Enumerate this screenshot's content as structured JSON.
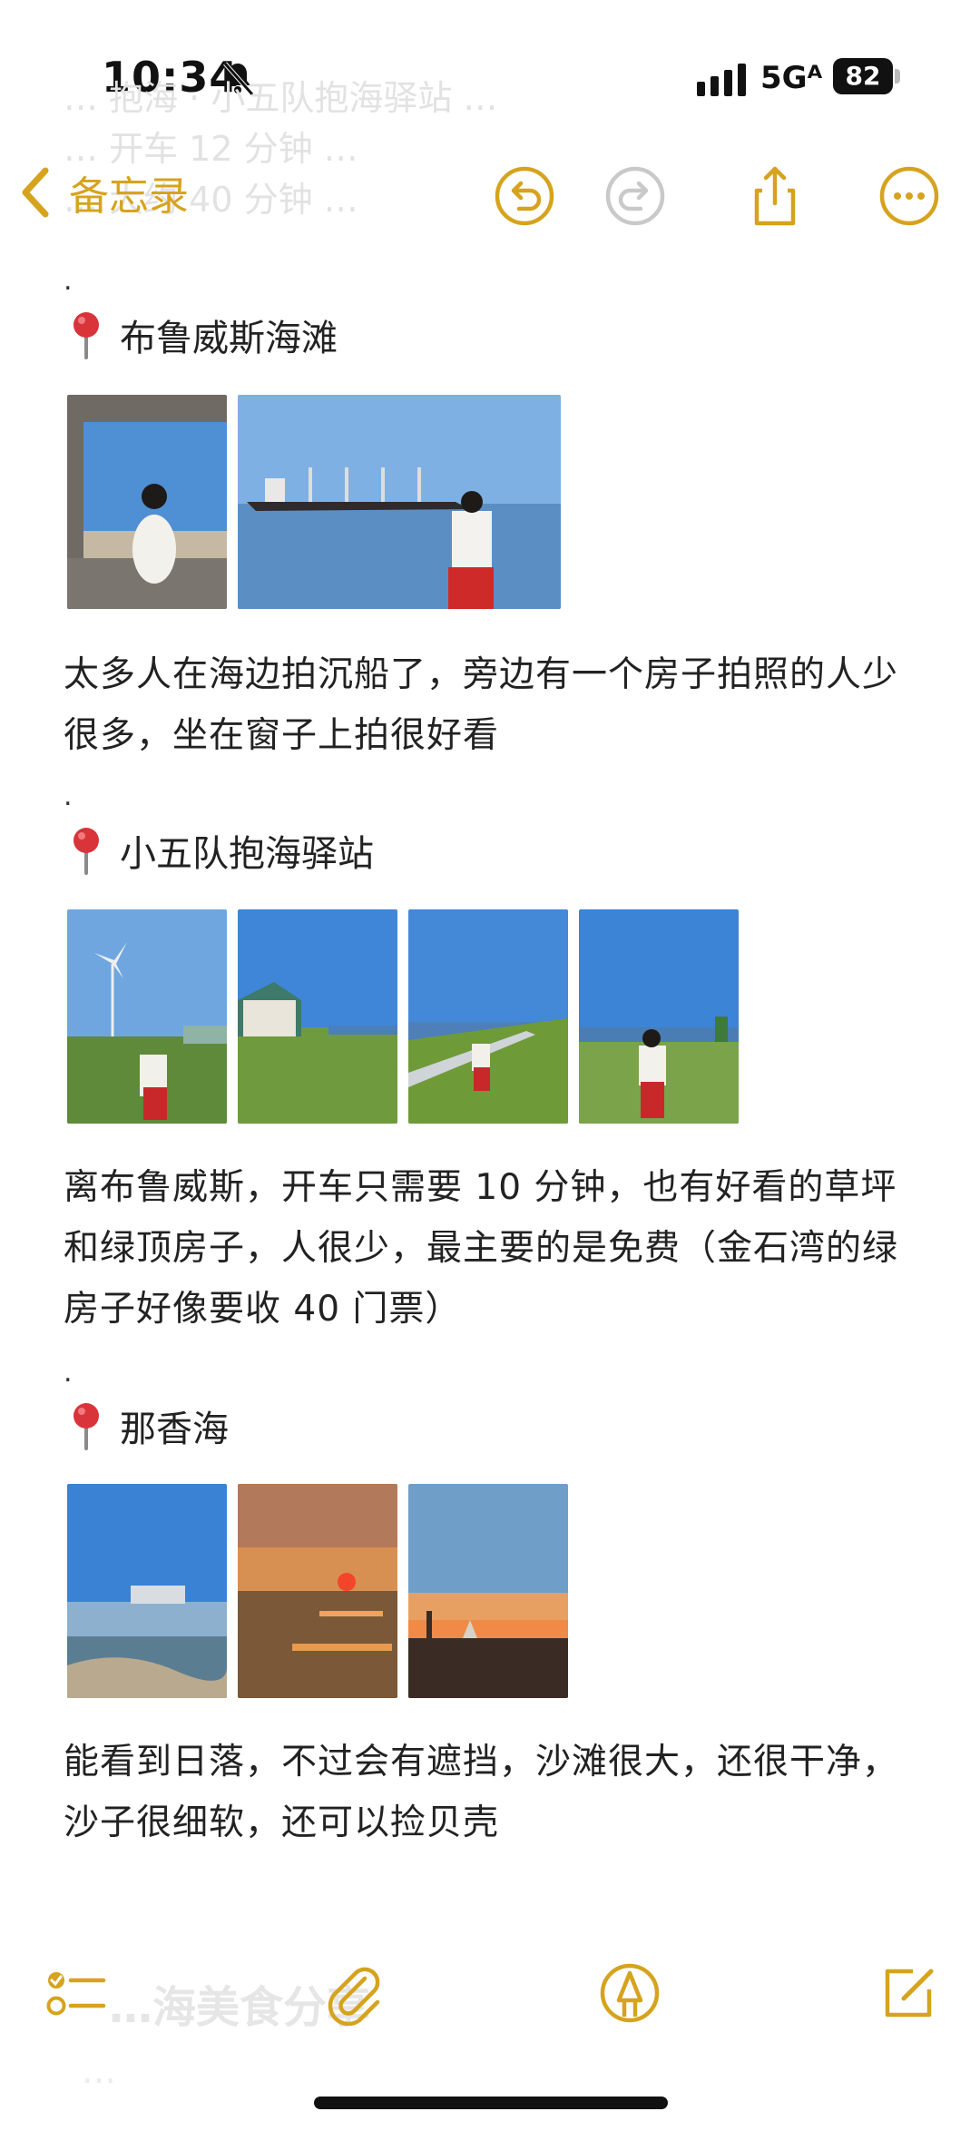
{
  "status": {
    "time": "10:34",
    "network": "5Gᴬ",
    "battery": "82"
  },
  "ghost": {
    "line1": "… 抱海 · 小五队抱海驿站 …",
    "line2": "… 开车 12 分钟 …",
    "line3": "… 大约 40 分钟 …"
  },
  "nav": {
    "back_label": "备忘录"
  },
  "sections": [
    {
      "dot": ".",
      "title": "布鲁威斯海滩",
      "paragraph": "太多人在海边拍沉船了，旁边有一个房子拍照的人少很多，坐在窗子上拍很好看"
    },
    {
      "dot": ".",
      "title": "小五队抱海驿站",
      "paragraph": "离布鲁威斯，开车只需要 10 分钟，也有好看的草坪和绿顶房子，人很少，最主要的是免费（金石湾的绿房子好像要收 40 门票）"
    },
    {
      "dot": ".",
      "title": "那香海",
      "paragraph": "能看到日落，不过会有遮挡，沙滩很大，还很干净，沙子很细软，还可以捡贝壳"
    }
  ],
  "bottom_ghost": {
    "heading": "…海美食分享",
    "sub": "…"
  },
  "colors": {
    "accent": "#d6a31e",
    "pin": "#d8343a"
  }
}
